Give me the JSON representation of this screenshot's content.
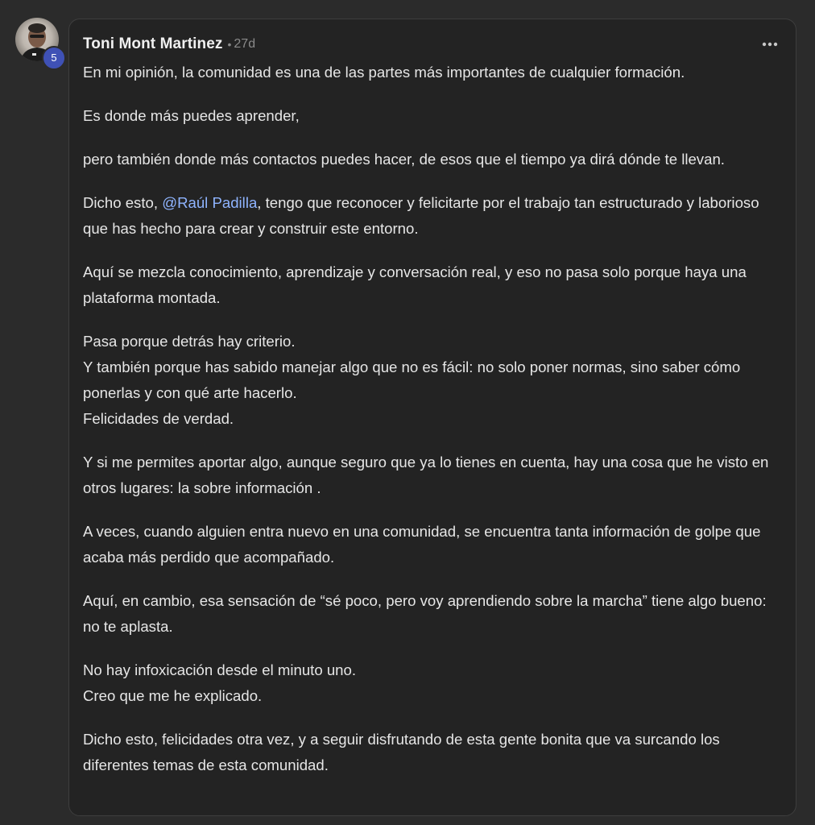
{
  "post": {
    "author": "Toni Mont Martinez",
    "separator": "•",
    "age": "27d",
    "level": "5",
    "more_icon": "more-horizontal-icon",
    "colors": {
      "background": "#2b2b2b",
      "card": "#232323",
      "mention": "#8fb4ff",
      "level_badge": "#3f51b5"
    },
    "paragraphs": {
      "p1": "En mi opinión, la comunidad es una de las partes más importantes de cualquier formación.",
      "p2": "Es donde más puedes aprender,",
      "p3": "pero también donde más contactos puedes hacer, de esos que el tiempo ya dirá dónde te llevan.",
      "p4_before": "Dicho esto, ",
      "p4_mention": "@Raúl Padilla",
      "p4_after": ", tengo que reconocer y felicitarte por el trabajo tan estructurado y laborioso que has hecho para crear y construir este entorno.",
      "p5": "Aquí se mezcla conocimiento, aprendizaje y conversación real, y eso no pasa solo porque haya una plataforma montada.",
      "p6_l1": "Pasa porque detrás hay criterio.",
      "p6_l2": "Y también porque has sabido manejar algo que no es fácil: no solo poner normas, sino saber cómo ponerlas y con qué arte hacerlo.",
      "p6_l3": "Felicidades de verdad.",
      "p7": "Y si me permites aportar algo, aunque seguro que ya lo tienes en cuenta, hay una cosa que he visto en otros lugares: la sobre información .",
      "p8": "A veces, cuando alguien entra nuevo en una comunidad, se encuentra tanta información de golpe que acaba más perdido que acompañado.",
      "p9": "Aquí, en cambio, esa sensación de “sé poco, pero voy aprendiendo sobre la marcha” tiene algo bueno: no te aplasta.",
      "p10_l1": "No hay infoxicación desde el minuto uno.",
      "p10_l2": "Creo que me he explicado.",
      "p11": "Dicho esto, felicidades otra vez, y a seguir disfrutando de esta gente bonita que va surcando los diferentes temas de esta comunidad."
    }
  }
}
